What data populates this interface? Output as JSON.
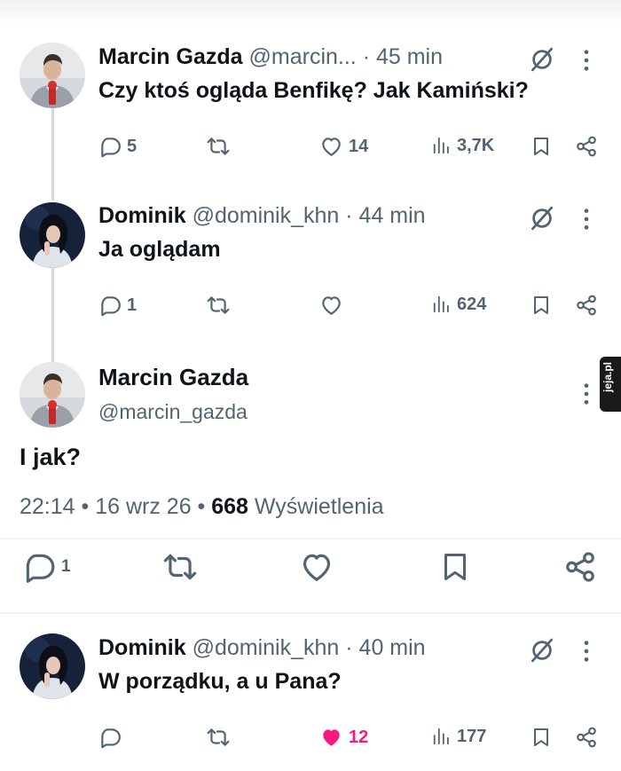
{
  "tweets": [
    {
      "name": "Marcin Gazda",
      "handle": "@marcin...",
      "time": "· 45 min",
      "text": "Czy ktoś ogląda Benfikę? Jak Kamiński?",
      "reply_count": "5",
      "retweet_count": "",
      "like_count": "14",
      "views": "3,7K"
    },
    {
      "name": "Dominik",
      "handle": "@dominik_khn",
      "time": "· 44 min",
      "text": "Ja oglądam",
      "reply_count": "1",
      "retweet_count": "",
      "like_count": "",
      "views": "624"
    }
  ],
  "main_tweet": {
    "name": "Marcin Gazda",
    "handle": "@marcin_gazda",
    "text": "I jak?",
    "timestamp": "22:14 • 16 wrz 26 • ",
    "views_count": "668",
    "views_label": " Wyświetlenia",
    "reply_count": "1"
  },
  "reply_tweet": {
    "name": "Dominik",
    "handle": "@dominik_khn",
    "time": "· 40 min",
    "text": "W porządku, a u Pana?",
    "reply_count": "",
    "like_count": "12",
    "liked": true,
    "views": "177"
  },
  "watermark": "jeja.pl",
  "colors": {
    "text": "#0f1419",
    "secondary": "#536471",
    "like_active": "#f91880",
    "thread_line": "#cfd9de"
  },
  "icons": [
    "reply-icon",
    "retweet-icon",
    "like-icon",
    "views-icon",
    "bookmark-icon",
    "share-icon",
    "grok-icon",
    "more-icon"
  ]
}
